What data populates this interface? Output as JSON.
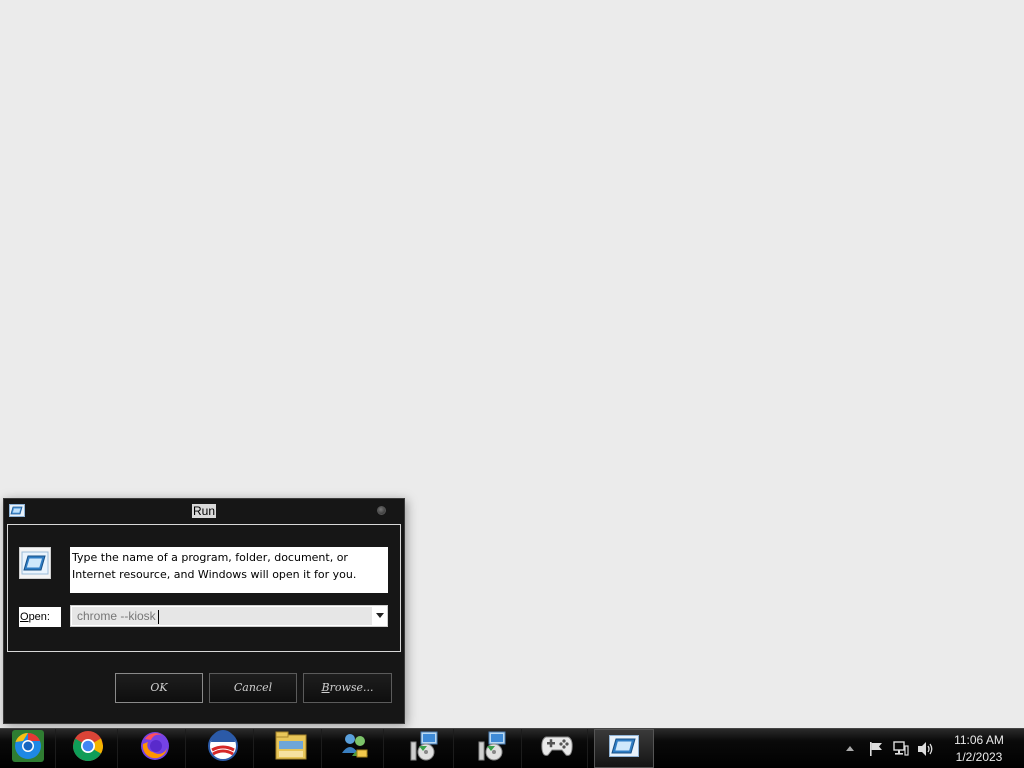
{
  "dialog": {
    "title": "Run",
    "description_line1": "Type the name of a program, folder, document, or",
    "description_line2": "Internet resource, and Windows will open it for you.",
    "open_label_mnemonic": "O",
    "open_label_rest": "pen:",
    "input_placeholder": "chrome --kiosk",
    "ok_label": "OK",
    "cancel_label": "Cancel",
    "browse_mnemonic": "B",
    "browse_rest": "rowse..."
  },
  "taskbar": {
    "apps": [
      {
        "name": "chromium-icon"
      },
      {
        "name": "chrome-icon"
      },
      {
        "name": "firefox-icon"
      },
      {
        "name": "obama-logo-icon"
      },
      {
        "name": "file-explorer-icon"
      },
      {
        "name": "network-users-icon"
      },
      {
        "name": "installer-disc-icon"
      },
      {
        "name": "installer-disc-icon"
      },
      {
        "name": "gamepad-icon"
      },
      {
        "name": "run-icon",
        "active": true
      }
    ],
    "clock_time": "11:06 AM",
    "clock_date": "1/2/2023"
  },
  "colors": {
    "desktop": "#ebebeb",
    "dialog_bg": "#161616",
    "taskbar_bg": "#000000"
  }
}
